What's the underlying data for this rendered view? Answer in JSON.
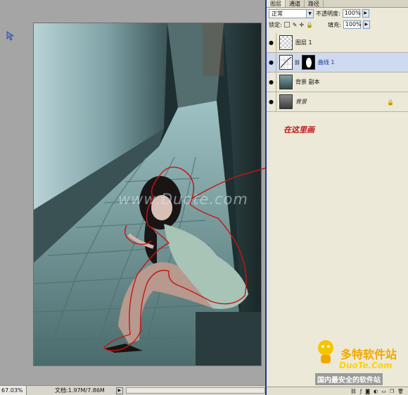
{
  "panel": {
    "tabs": [
      "图层",
      "通道",
      "路径"
    ],
    "blend_mode": "正常",
    "opacity_label": "不透明度:",
    "opacity_value": "100%",
    "lock_label": "锁定:",
    "fill_label": "填充:",
    "fill_value": "100%",
    "layers": [
      {
        "name": "图层 1",
        "selected": false
      },
      {
        "name": "曲线 1",
        "selected": true
      },
      {
        "name": "背景 副本",
        "selected": false
      },
      {
        "name": "背景",
        "selected": false
      }
    ]
  },
  "status": {
    "zoom": "67.03%",
    "doc": "文档:1.97M/7.86M"
  },
  "annotation": {
    "text": "在这里画"
  },
  "watermark": {
    "text": "www.Duote.com"
  },
  "logo": {
    "main": "多特软件站",
    "sub": "DuoTe.Com",
    "tag": "国内最安全的软件站"
  },
  "colors": {
    "selection_border": "#1c3a8c",
    "annotation_red": "#c41515",
    "logo_orange": "#f0a800"
  }
}
